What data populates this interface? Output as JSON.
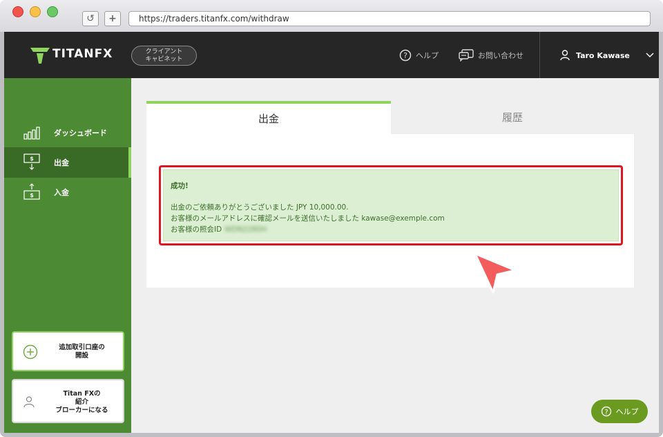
{
  "browser": {
    "url": "https://traders.titanfx.com/withdraw",
    "reload_glyph": "↺",
    "newtab_glyph": "+"
  },
  "header": {
    "logo_text": "TITANFX",
    "client_cabinet_line1": "クライアント",
    "client_cabinet_line2": "キャビネット",
    "help_label": "ヘルプ",
    "contact_label": "お問い合わせ",
    "user_name": "Taro Kawase"
  },
  "sidebar": {
    "items": [
      {
        "label": "ダッシュボード",
        "icon": "bar-chart-icon"
      },
      {
        "label": "出金",
        "icon": "withdraw-icon"
      },
      {
        "label": "入金",
        "icon": "deposit-icon"
      }
    ],
    "open_account_label": "追加取引口座の開設",
    "open_account_line1": "追加取引口座の",
    "open_account_line2": "開設",
    "ib_line1": "Titan FXの",
    "ib_line2": "紹介",
    "ib_line3": "ブローカーになる"
  },
  "tabs": [
    {
      "label": "出金",
      "active": true
    },
    {
      "label": "履歴",
      "active": false
    }
  ],
  "alert": {
    "title": "成功!",
    "line1": "出金のご依頼ありがとうございました JPY 10,000.00.",
    "line2": "お客様のメールアドレスに確認メールを送信いたしました kawase@exemple.com",
    "line3": "お客様の照会ID",
    "reference_id_blurred": "WDN2280H"
  },
  "help_fab_label": "ヘルプ",
  "colors": {
    "accent_green": "#8fd45f",
    "sidebar_green": "#4c8a33",
    "header_dark": "#262626",
    "alert_bg": "#dcefd3",
    "highlight_red": "#e0151f"
  }
}
